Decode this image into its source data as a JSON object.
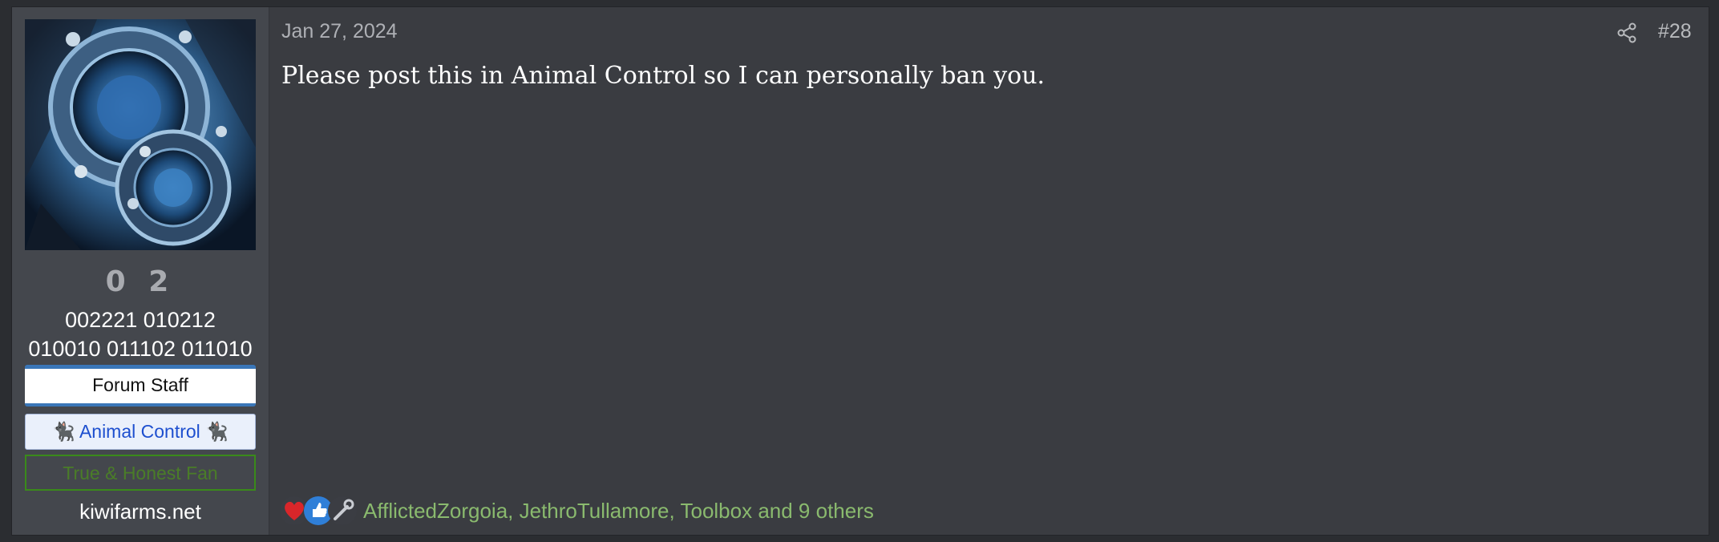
{
  "user": {
    "name": "0 2",
    "title": "002221 010212 010010 011102 011010",
    "banners": [
      "Forum Staff",
      "Animal Control",
      "True & Honest Fan"
    ],
    "banner_ac_emoji": "🐈‍⬛",
    "site": "kiwifarms.net"
  },
  "post": {
    "date": "Jan 27, 2024",
    "number": "#28",
    "message": "Please post this in Animal Control so I can personally ban you."
  },
  "reactions": {
    "icons": [
      "heart-icon",
      "thumbs-up-icon",
      "wrench-icon"
    ],
    "summary": "AfflictedZorgoia, JethroTullamore, Toolbox and 9 others"
  },
  "colors": {
    "page_bg": "#2b2d31",
    "post_bg": "#3a3c41",
    "sidebar_bg": "#44474d",
    "staff_border": "#3a76b8",
    "animal_control_text": "#1d4fcf",
    "fan_border": "#3a8a1a",
    "reaction_text": "#8aba6e"
  }
}
